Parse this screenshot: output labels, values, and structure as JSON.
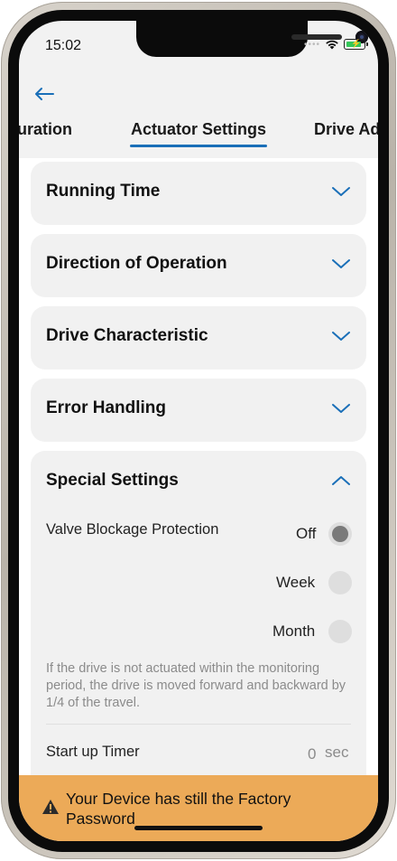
{
  "status_bar": {
    "time": "15:02",
    "signal": "••••"
  },
  "nav": {
    "back_icon": "arrow-left-icon"
  },
  "tabs": [
    {
      "label": "uration",
      "active": false
    },
    {
      "label": "Actuator Settings",
      "active": true
    },
    {
      "label": "Drive Ad",
      "active": false
    }
  ],
  "sections": [
    {
      "title": "Running Time",
      "expanded": false
    },
    {
      "title": "Direction of Operation",
      "expanded": false
    },
    {
      "title": "Drive Characteristic",
      "expanded": false
    },
    {
      "title": "Error Handling",
      "expanded": false
    }
  ],
  "special_settings": {
    "title": "Special Settings",
    "expanded": true,
    "valve_blockage": {
      "label": "Valve Blockage Protection",
      "options": [
        {
          "label": "Off",
          "selected": true
        },
        {
          "label": "Week",
          "selected": false
        },
        {
          "label": "Month",
          "selected": false
        }
      ],
      "hint": "If the drive is not actuated within the monitoring period, the drive is moved forward and backward by 1/4 of the travel."
    },
    "startup_timer": {
      "label": "Start up Timer",
      "value": "0",
      "unit": "sec"
    }
  },
  "banner": {
    "icon": "warning-icon",
    "text": "Your Device has still the Factory Password"
  },
  "colors": {
    "accent": "#1a6fb8",
    "banner_bg": "#ecaa58",
    "card_bg": "#f1f1f1",
    "radio_selected": "#7a7a7a",
    "battery": "#34c759"
  }
}
